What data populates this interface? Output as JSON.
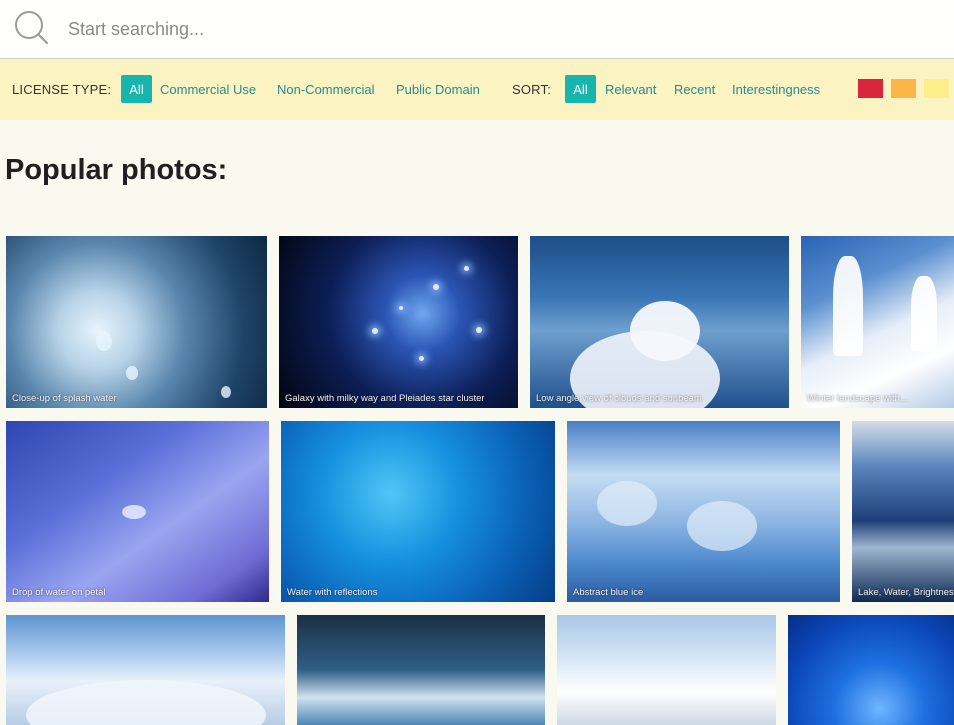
{
  "search": {
    "placeholder": "Start searching..."
  },
  "filters": {
    "license_label": "LICENSE TYPE:",
    "license_options": [
      "All",
      "Commercial Use",
      "Non-Commercial",
      "Public Domain"
    ],
    "license_selected": "All",
    "sort_label": "SORT:",
    "sort_options": [
      "All",
      "Relevant",
      "Recent",
      "Interestingness"
    ],
    "sort_selected": "All",
    "color_swatches": [
      "#d9263c",
      "#fbb549",
      "#fbef8a"
    ]
  },
  "section_title": "Popular photos:",
  "photos": [
    {
      "caption": "Close-up of splash water"
    },
    {
      "caption": "Galaxy with milky way and Pleiades star cluster"
    },
    {
      "caption": "Low angle view of clouds and sunbeam"
    },
    {
      "caption": "Winter landscape with..."
    },
    {
      "caption": "Drop of water on petal"
    },
    {
      "caption": "Water with reflections"
    },
    {
      "caption": "Abstract blue ice"
    },
    {
      "caption": "Lake, Water, Brightness"
    },
    {
      "caption": ""
    },
    {
      "caption": ""
    },
    {
      "caption": ""
    },
    {
      "caption": ""
    }
  ],
  "colors": {
    "accent": "#16b5ad",
    "link": "#2a8a8e",
    "filter_bg": "#fbf3c2",
    "page_bg": "#faf9ef"
  }
}
